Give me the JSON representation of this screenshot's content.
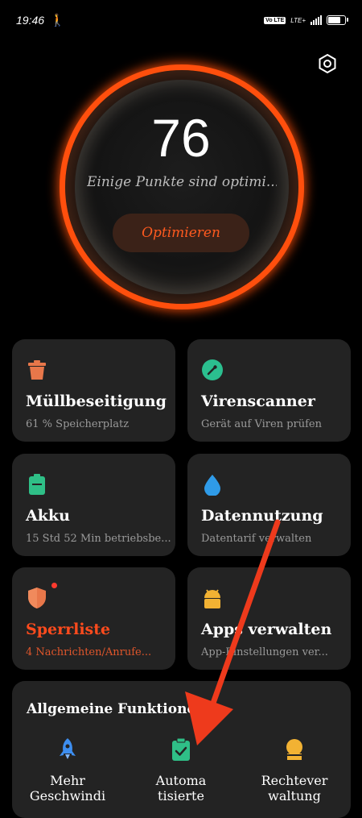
{
  "status_bar": {
    "time": "19:46",
    "volte": "Vo LTE",
    "lte": "LTE+"
  },
  "score": {
    "value": "76",
    "message": "Einige Punkte sind optimi...",
    "button": "Optimieren"
  },
  "cards": [
    {
      "title": "Müllbeseitigung",
      "subtitle": "61 % Speicherplatz",
      "icon": "trash-icon",
      "color": "#e8774a"
    },
    {
      "title": "Virenscanner",
      "subtitle": "Gerät auf Viren prüfen",
      "icon": "virus-scan-icon",
      "color": "#2bbf8f"
    },
    {
      "title": "Akku",
      "subtitle": "15 Std 52 Min betriebsbe...",
      "icon": "battery-icon",
      "color": "#2fbf87"
    },
    {
      "title": "Datennutzung",
      "subtitle": "Datentarif verwalten",
      "icon": "water-drop-icon",
      "color": "#2f9be8"
    },
    {
      "title": "Sperrliste",
      "subtitle": "4 Nachrichten/Anrufe...",
      "icon": "shield-icon",
      "color": "#e8774a"
    },
    {
      "title": "Apps verwalten",
      "subtitle": "App-Einstellungen ver...",
      "icon": "android-icon",
      "color": "#f2b233"
    }
  ],
  "general": {
    "title": "Allgemeine Funktionen",
    "items": [
      {
        "label_line1": "Mehr",
        "label_line2": "Geschwindi",
        "icon": "rocket-icon",
        "color": "#3d8ef0"
      },
      {
        "label_line1": "Automa",
        "label_line2": "tisierte",
        "icon": "clipboard-check-icon",
        "color": "#2fbf87"
      },
      {
        "label_line1": "Rechtever",
        "label_line2": "waltung",
        "icon": "badge-icon",
        "color": "#f2b233"
      }
    ]
  },
  "accent_color": "#ff4f0d",
  "annotation_arrow_color": "#ee3a1c"
}
